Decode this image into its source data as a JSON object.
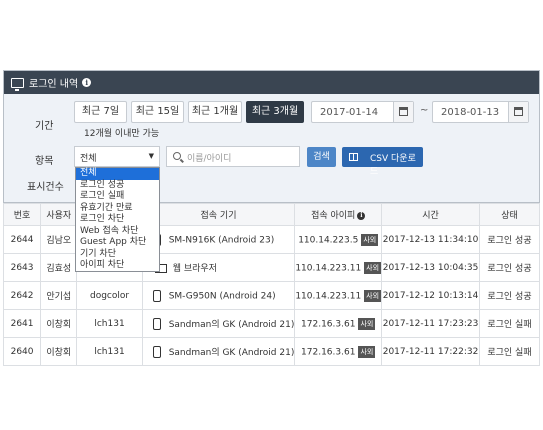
{
  "panel": {
    "title": "로그인 내역"
  },
  "filters": {
    "period_label": "기간",
    "period_buttons": [
      "최근 7일",
      "최근 15일",
      "최근 1개월",
      "최근 3개월"
    ],
    "start_date": "2017-01-14",
    "end_date": "2018-01-13",
    "tilde": "~",
    "period_hint": "12개월 이내만 가능",
    "item_label": "항목",
    "item_selected": "전체",
    "search_placeholder": "이름/아이디",
    "search_button": "검색",
    "csv_button": "CSV 다운로드",
    "display_count_label": "표시건수"
  },
  "dropdown": {
    "options": [
      "전체",
      "로그인 성공",
      "로그인 실패",
      "유효기간 만료",
      "로그인 차단",
      "Web 접속 차단",
      "Guest App 차단",
      "기기 차단",
      "아이피 차단"
    ]
  },
  "table": {
    "headers": [
      "번호",
      "사용자",
      "",
      "접속 기기",
      "접속 아이피",
      "시간",
      "상태"
    ],
    "rows": [
      {
        "no": "2644",
        "user": "김남오",
        "id": "",
        "device": "SM-N916K (Android 23)",
        "ip": "110.14.223.5",
        "badge": "사외",
        "time": "2017-12-13 11:34:10",
        "status": "로그인 성공"
      },
      {
        "no": "2643",
        "user": "김효성",
        "id": "",
        "device": "웹 브라우저",
        "ip": "110.14.223.11",
        "badge": "사외",
        "time": "2017-12-13 10:04:35",
        "status": "로그인 성공"
      },
      {
        "no": "2642",
        "user": "안기섭",
        "id": "dogcolor",
        "device": "SM-G950N (Android 24)",
        "ip": "110.14.223.11",
        "badge": "사외",
        "time": "2017-12-12 10:13:14",
        "status": "로그인 성공"
      },
      {
        "no": "2641",
        "user": "이창회",
        "id": "lch131",
        "device": "Sandman의 GK (Android 21)",
        "ip": "172.16.3.61",
        "badge": "사외",
        "time": "2017-12-11 17:23:23",
        "status": "로그인 실패"
      },
      {
        "no": "2640",
        "user": "이창회",
        "id": "lch131",
        "device": "Sandman의 GK (Android 21)",
        "ip": "172.16.3.61",
        "badge": "사외",
        "time": "2017-12-11 17:22:32",
        "status": "로그인 실패"
      }
    ]
  }
}
